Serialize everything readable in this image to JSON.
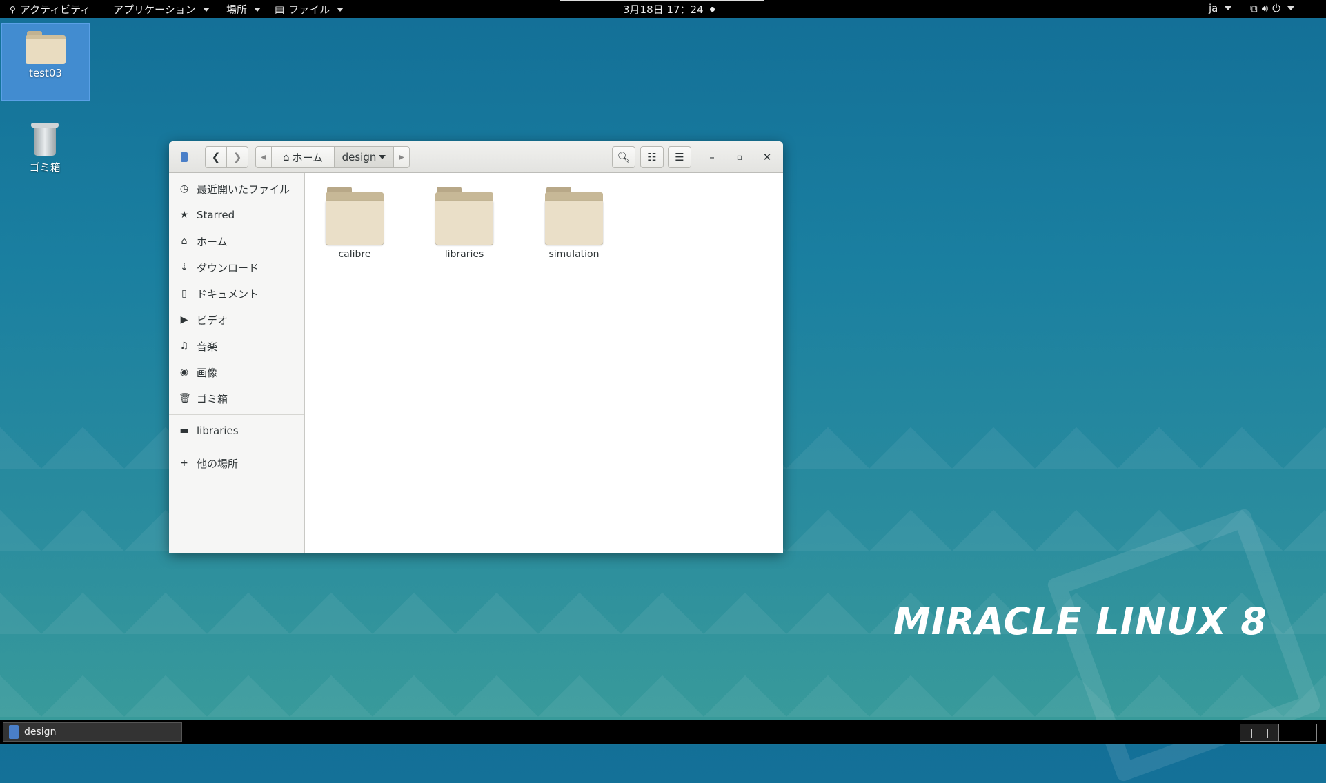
{
  "topbar": {
    "activities": "アクティビティ",
    "applications": "アプリケーション",
    "places": "場所",
    "files_app": "ファイル",
    "clock": "3月18日 17：24",
    "lang": "ja"
  },
  "desktop": {
    "icons": [
      {
        "label": "test03"
      },
      {
        "label": "ゴミ箱"
      }
    ]
  },
  "window": {
    "path": {
      "home": "ホーム",
      "current": "design"
    },
    "sidebar": {
      "items": [
        {
          "label": "最近開いたファイル",
          "icon": "clock-icon"
        },
        {
          "label": "Starred",
          "icon": "star-icon"
        },
        {
          "label": "ホーム",
          "icon": "home-icon"
        },
        {
          "label": "ダウンロード",
          "icon": "download-icon"
        },
        {
          "label": "ドキュメント",
          "icon": "document-icon"
        },
        {
          "label": "ビデオ",
          "icon": "video-icon"
        },
        {
          "label": "音楽",
          "icon": "music-icon"
        },
        {
          "label": "画像",
          "icon": "camera-icon"
        },
        {
          "label": "ゴミ箱",
          "icon": "trash-icon"
        }
      ],
      "bookmarks": [
        {
          "label": "libraries",
          "icon": "folder-icon"
        }
      ],
      "other": {
        "label": "他の場所",
        "icon": "plus-icon"
      }
    },
    "files": [
      {
        "name": "calibre"
      },
      {
        "name": "libraries"
      },
      {
        "name": "simulation"
      }
    ]
  },
  "brand": {
    "logo": "MIRACLE LINUX 8"
  },
  "taskbar": {
    "task_label": "design"
  }
}
